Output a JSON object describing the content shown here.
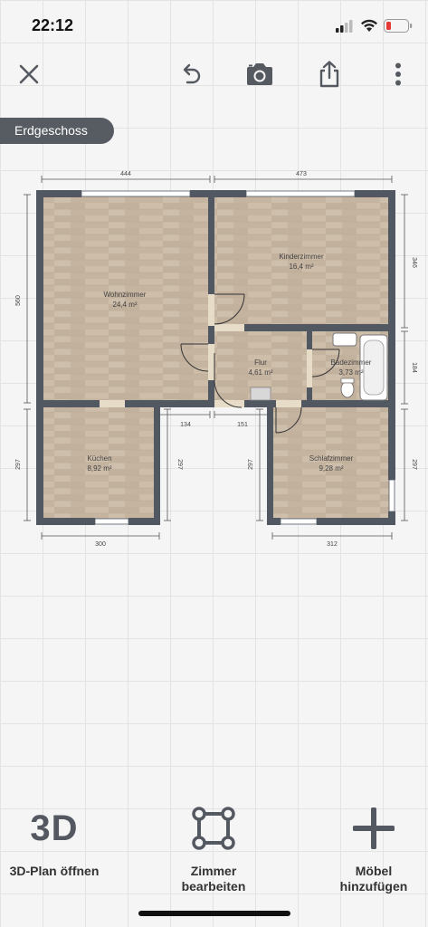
{
  "status": {
    "time": "22:12"
  },
  "floor": {
    "name": "Erdgeschoss"
  },
  "rooms": [
    {
      "name": "Wohnzimmer",
      "area": "24,4 m²"
    },
    {
      "name": "Kinderzimmer",
      "area": "16,4 m²"
    },
    {
      "name": "Flur",
      "area": "4,61 m²"
    },
    {
      "name": "Badezimmer",
      "area": "3,73 m²"
    },
    {
      "name": "Küchen",
      "area": "8,92 m²"
    },
    {
      "name": "Schlafzimmer",
      "area": "9,28 m²"
    }
  ],
  "dimensions": [
    "444",
    "473",
    "560",
    "346",
    "184",
    "134",
    "151",
    "297",
    "297",
    "297",
    "297",
    "300",
    "312"
  ],
  "bottom": {
    "three_d_icon": "3D",
    "three_d_label": "3D-Plan öffnen",
    "edit_rooms_label_1": "Zimmer",
    "edit_rooms_label_2": "bearbeiten",
    "add_furniture_label_1": "Möbel",
    "add_furniture_label_2": "hinzufügen"
  },
  "colors": {
    "wall": "#515862",
    "wood": "#c8b8a4",
    "floor_badge": "#575c63",
    "battery_low": "#e53935"
  },
  "icons": [
    "close-icon",
    "undo-icon",
    "camera-icon",
    "share-icon",
    "more-vertical-icon",
    "edit-rooms-icon",
    "plus-icon"
  ]
}
